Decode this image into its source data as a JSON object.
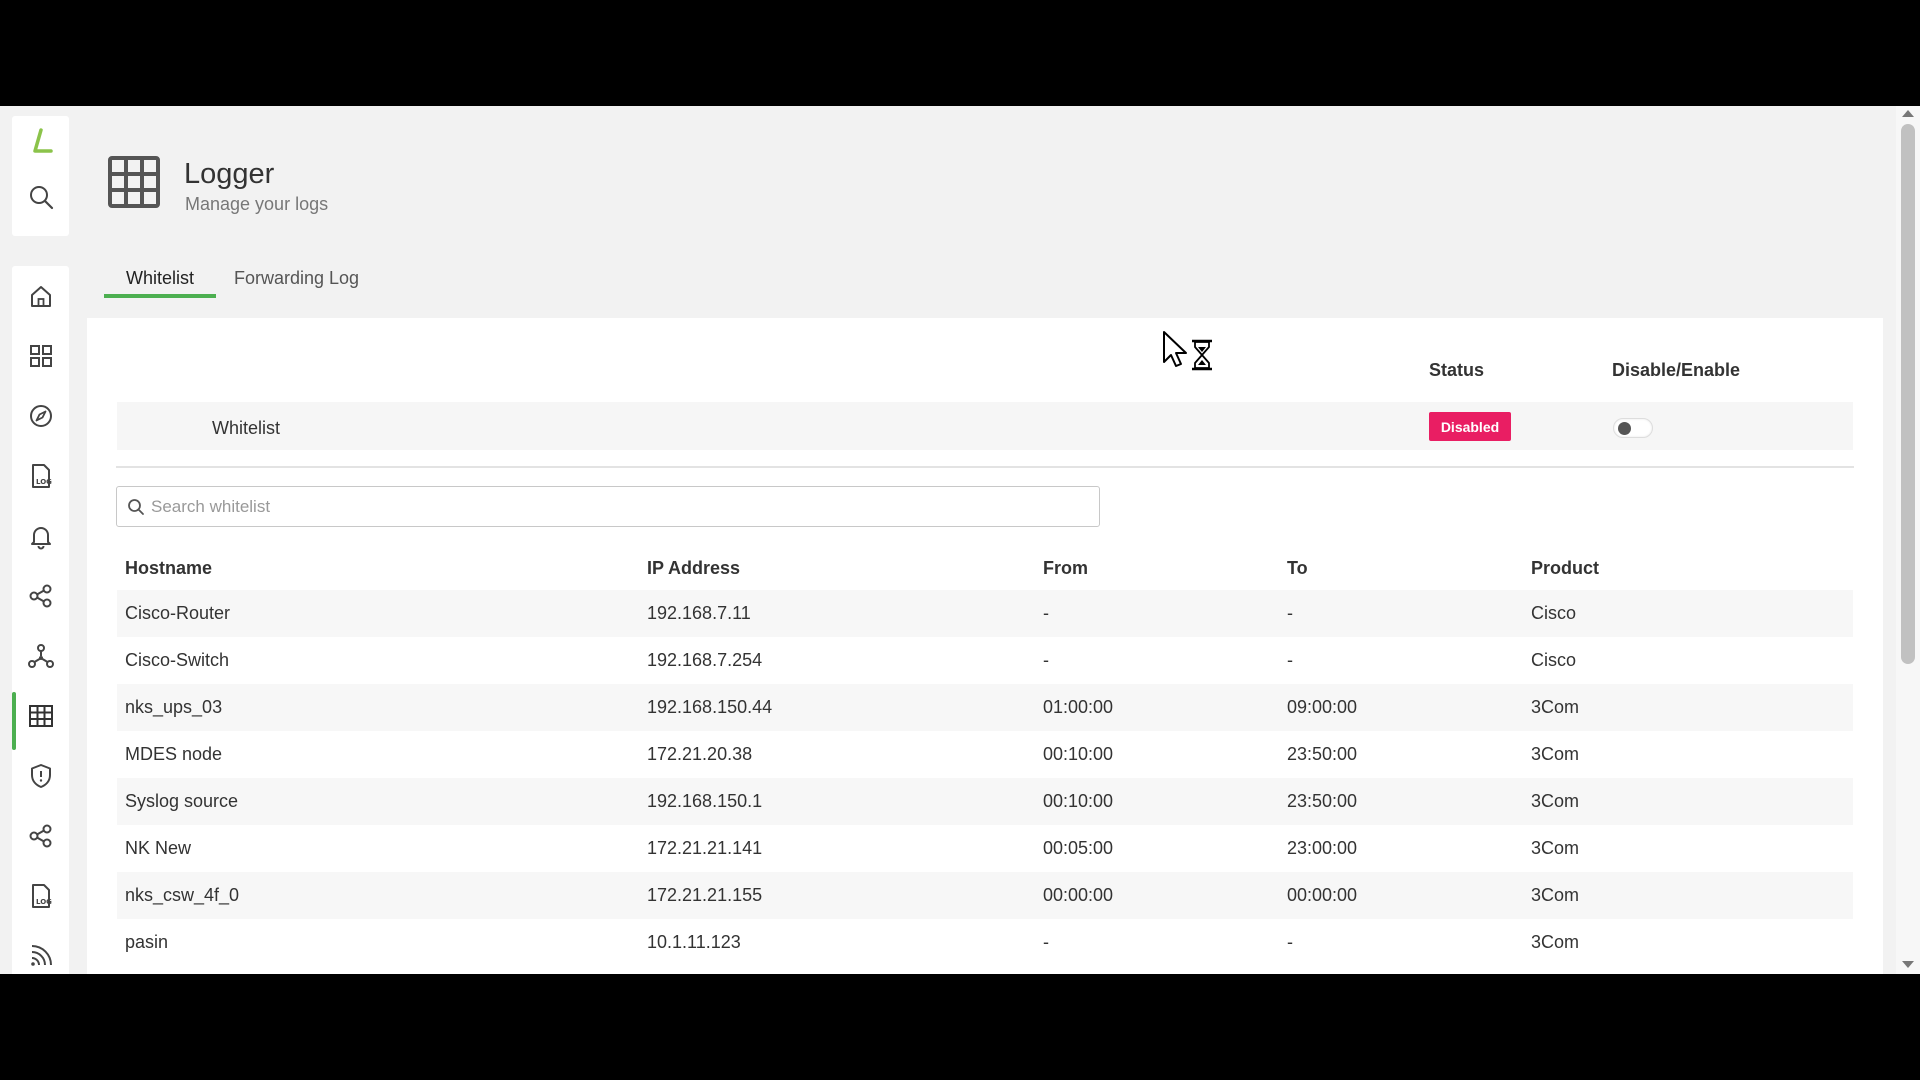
{
  "header": {
    "title": "Logger",
    "subtitle": "Manage your logs"
  },
  "tabs": [
    {
      "label": "Whitelist",
      "active": true
    },
    {
      "label": "Forwarding Log",
      "active": false
    }
  ],
  "whitelist_setting": {
    "status_header": "Status",
    "toggle_header": "Disable/Enable",
    "name": "Whitelist",
    "status": "Disabled",
    "enabled": false
  },
  "search": {
    "placeholder": "Search whitelist",
    "value": ""
  },
  "table": {
    "columns": [
      "Hostname",
      "IP Address",
      "From",
      "To",
      "Product"
    ],
    "rows": [
      {
        "hostname": "Cisco-Router",
        "ip": "192.168.7.11",
        "from": "-",
        "to": "-",
        "product": "Cisco"
      },
      {
        "hostname": "Cisco-Switch",
        "ip": "192.168.7.254",
        "from": "-",
        "to": "-",
        "product": "Cisco"
      },
      {
        "hostname": "nks_ups_03",
        "ip": "192.168.150.44",
        "from": "01:00:00",
        "to": "09:00:00",
        "product": "3Com"
      },
      {
        "hostname": "MDES node",
        "ip": "172.21.20.38",
        "from": "00:10:00",
        "to": "23:50:00",
        "product": "3Com"
      },
      {
        "hostname": "Syslog source",
        "ip": "192.168.150.1",
        "from": "00:10:00",
        "to": "23:50:00",
        "product": "3Com"
      },
      {
        "hostname": "NK New",
        "ip": "172.21.21.141",
        "from": "00:05:00",
        "to": "23:00:00",
        "product": "3Com"
      },
      {
        "hostname": "nks_csw_4f_0",
        "ip": "172.21.21.155",
        "from": "00:00:00",
        "to": "00:00:00",
        "product": "3Com"
      },
      {
        "hostname": "pasin",
        "ip": "10.1.11.123",
        "from": "-",
        "to": "-",
        "product": "3Com"
      }
    ]
  },
  "sidebar": {
    "top": [
      "logo-icon",
      "search-icon"
    ],
    "items": [
      "home-icon",
      "dashboard-grid-icon",
      "compass-icon",
      "log-file-icon",
      "bell-icon",
      "share-icon",
      "network-icon",
      "table-grid-icon",
      "shield-icon",
      "share-icon",
      "log-file-icon",
      "rss-icon"
    ],
    "active_item": "table-grid-icon"
  },
  "colors": {
    "accent": "#4caf50",
    "danger": "#e91e63"
  }
}
